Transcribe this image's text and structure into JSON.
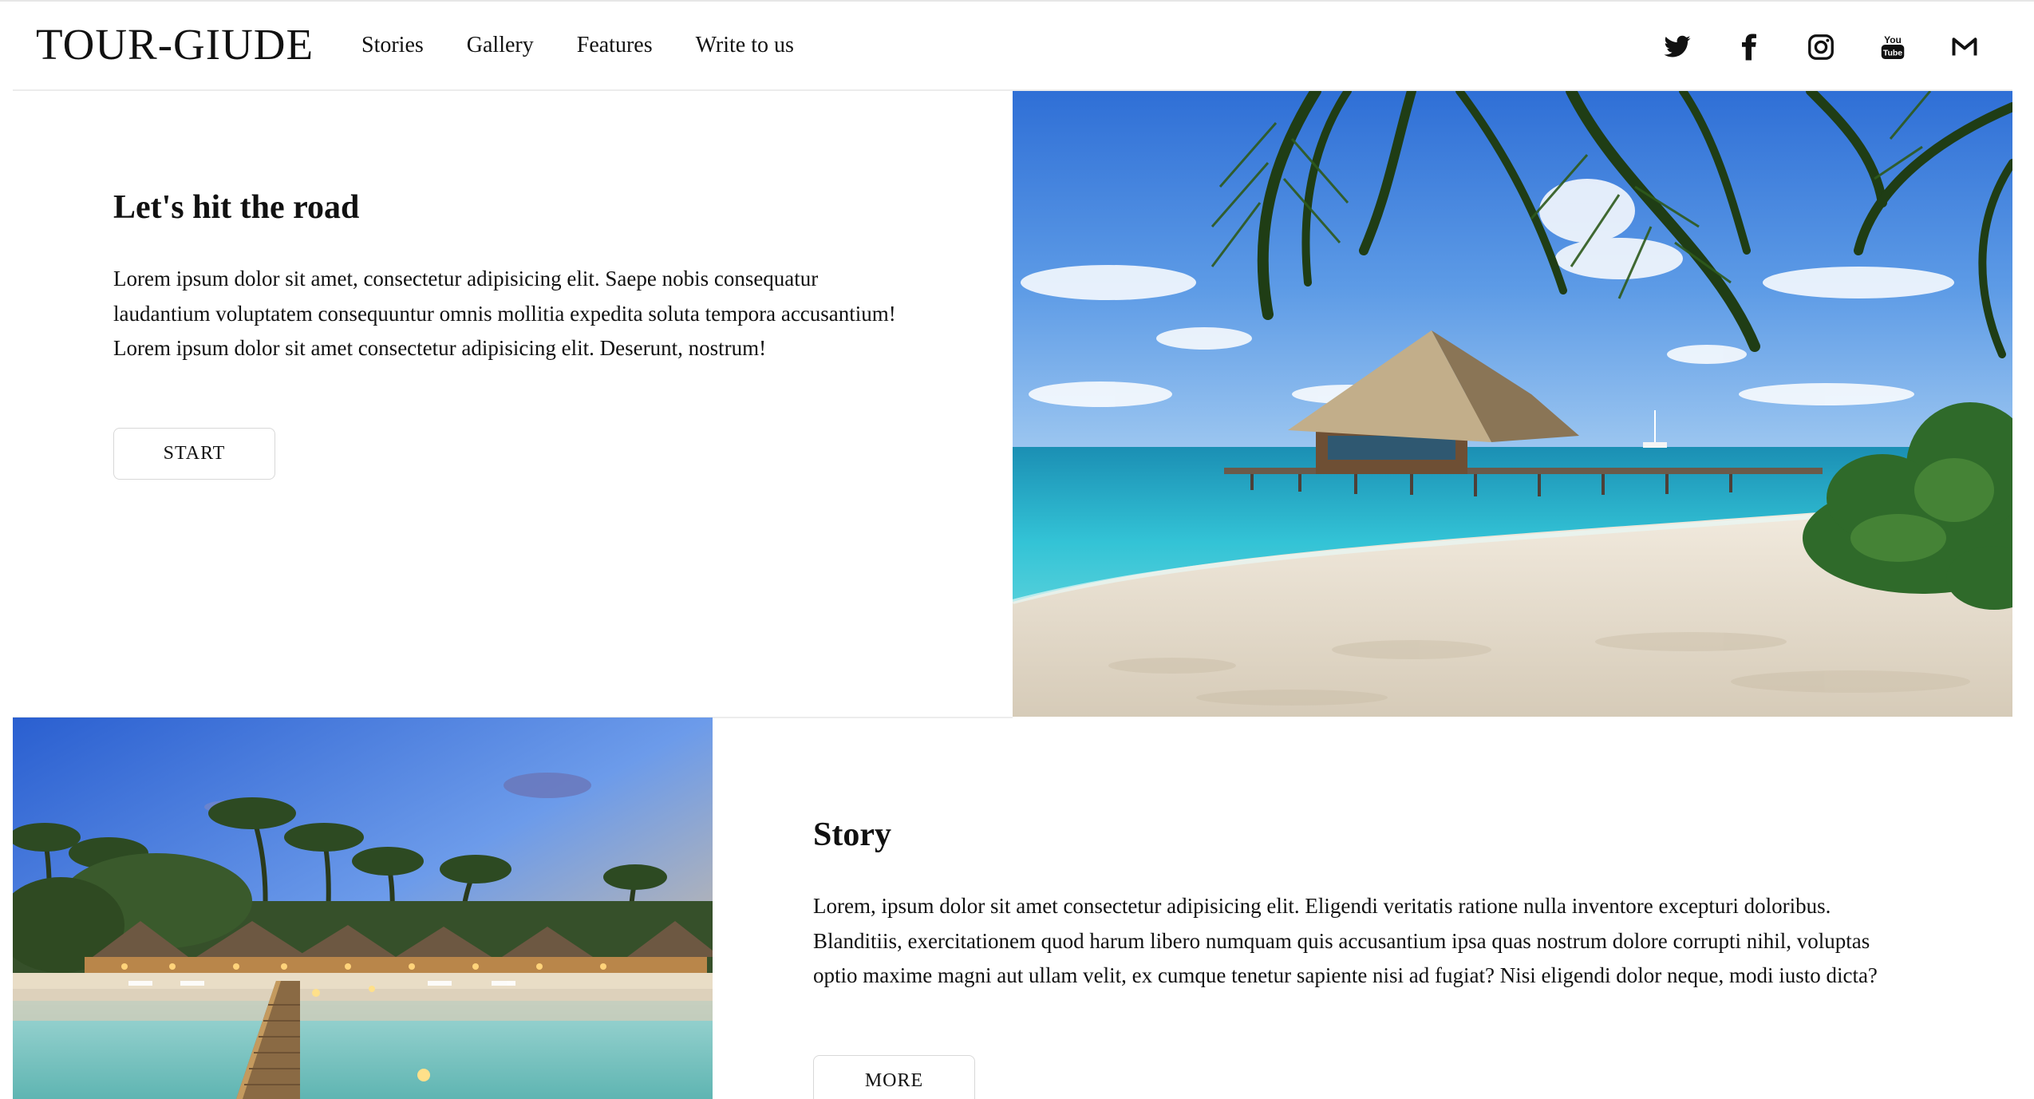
{
  "header": {
    "logo": "TOUR-GIUDE",
    "nav": [
      "Stories",
      "Gallery",
      "Features",
      "Write to us"
    ],
    "social": [
      "twitter-icon",
      "facebook-icon",
      "instagram-icon",
      "youtube-icon",
      "mail-icon"
    ]
  },
  "section1": {
    "title": "Let's hit the road",
    "paragraph1": "Lorem ipsum dolor sit amet, consectetur adipisicing elit. Saepe nobis consequatur laudantium voluptatem consequuntur omnis mollitia expedita soluta tempora accusantium!",
    "paragraph2": "Lorem ipsum dolor sit amet consectetur adipisicing elit. Deserunt, nostrum!",
    "button": "START"
  },
  "section2": {
    "title": "Story",
    "paragraph": "Lorem, ipsum dolor sit amet consectetur adipisicing elit. Eligendi veritatis ratione nulla inventore excepturi doloribus. Blanditiis, exercitationem quod harum libero numquam quis accusantium ipsa quas nostrum dolore corrupti nihil, voluptas optio maxime magni aut ullam velit, ex cumque tenetur sapiente nisi ad fugiat? Nisi eligendi dolor neque, modi iusto dicta?",
    "button": "MORE"
  },
  "colors": {
    "text": "#111111",
    "border": "#d8d8d8",
    "sea": "#3fc6d6",
    "sky": "#4a8fe0",
    "sand": "#ede3d2"
  }
}
